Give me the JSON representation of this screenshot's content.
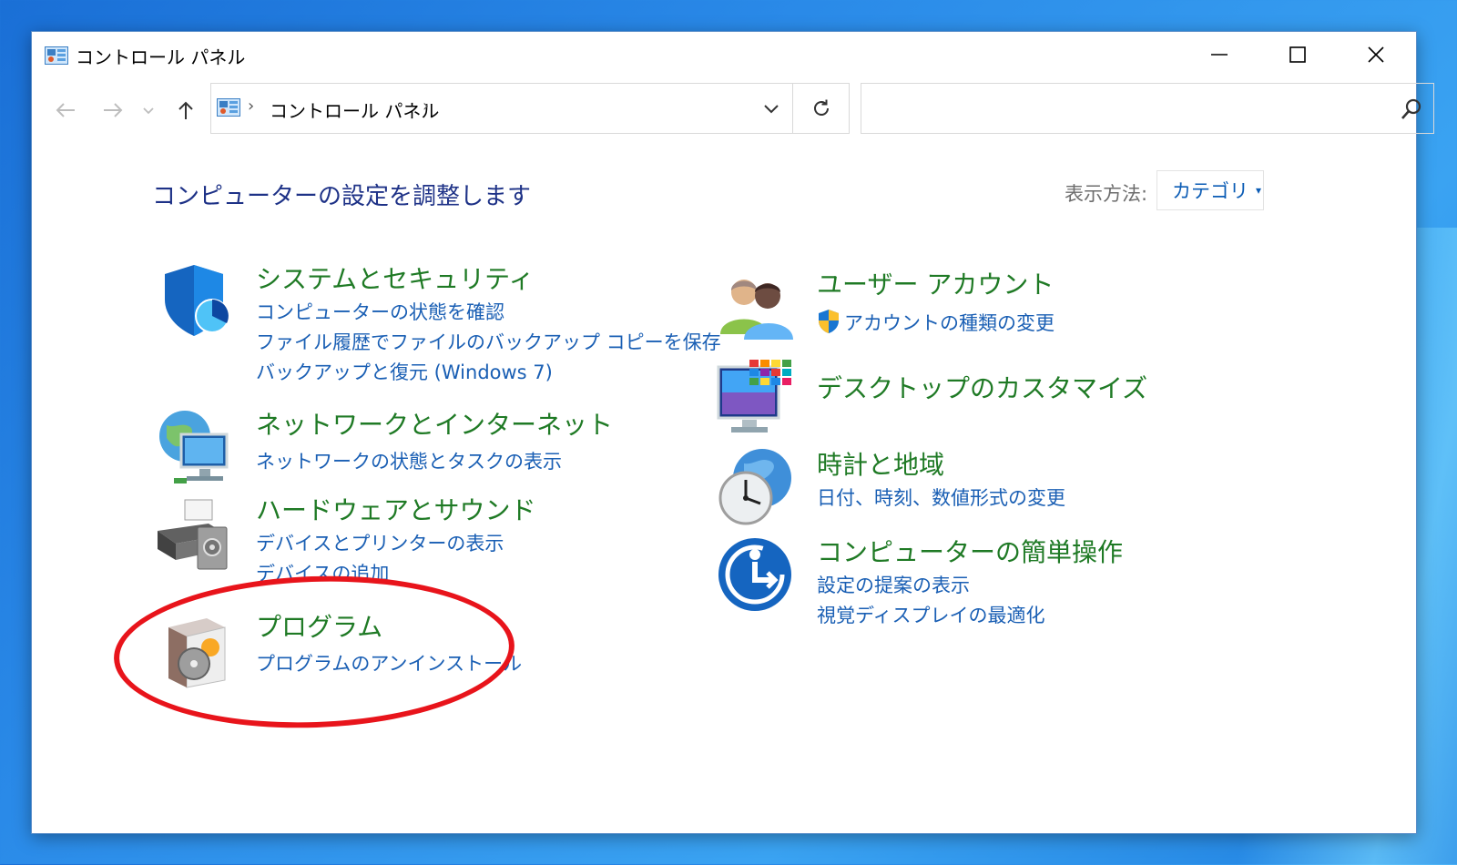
{
  "window": {
    "title": "コントロール パネル"
  },
  "address_bar": {
    "path": "コントロール パネル",
    "separator": "›"
  },
  "search": {
    "placeholder": ""
  },
  "header": {
    "title": "コンピューターの設定を調整します",
    "view_label": "表示方法:",
    "view_value": "カテゴリ"
  },
  "categories": {
    "system": {
      "title": "システムとセキュリティ",
      "links": [
        "コンピューターの状態を確認",
        "ファイル履歴でファイルのバックアップ コピーを保存",
        "バックアップと復元 (Windows 7)"
      ]
    },
    "network": {
      "title": "ネットワークとインターネット",
      "links": [
        "ネットワークの状態とタスクの表示"
      ]
    },
    "hardware": {
      "title": "ハードウェアとサウンド",
      "links": [
        "デバイスとプリンターの表示",
        "デバイスの追加"
      ]
    },
    "programs": {
      "title": "プログラム",
      "links": [
        "プログラムのアンインストール"
      ]
    },
    "users": {
      "title": "ユーザー アカウント",
      "links": [
        "アカウントの種類の変更"
      ]
    },
    "desktop": {
      "title": "デスクトップのカスタマイズ",
      "links": []
    },
    "clock": {
      "title": "時計と地域",
      "links": [
        "日付、時刻、数値形式の変更"
      ]
    },
    "ease": {
      "title": "コンピューターの簡単操作",
      "links": [
        "設定の提案の表示",
        "視覚ディスプレイの最適化"
      ]
    }
  },
  "colors": {
    "title_blue": "#1e3287",
    "category_green": "#1f7a25",
    "link_blue": "#1a5fb4",
    "highlight_red": "#e8141b"
  }
}
